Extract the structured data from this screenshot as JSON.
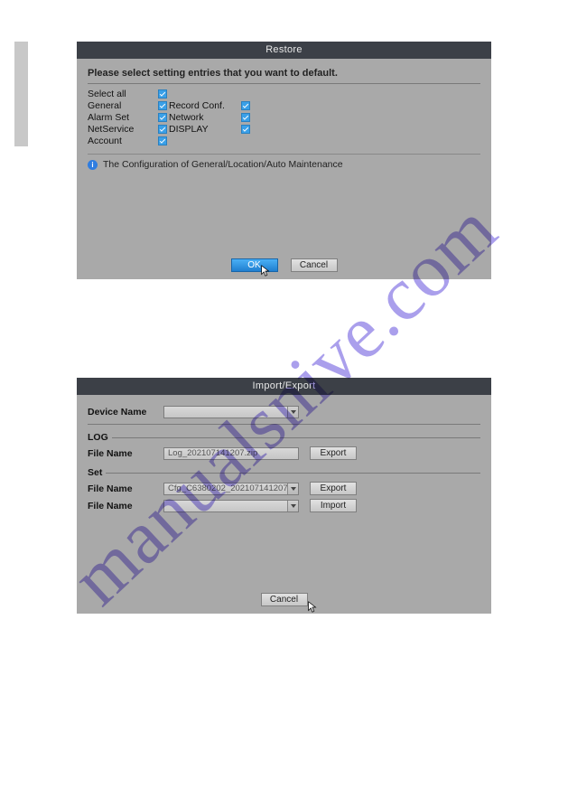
{
  "watermark": "manualsnive.com",
  "restore": {
    "title": "Restore",
    "instruction": "Please select setting entries that you want to default.",
    "checks_col1": [
      "Select all",
      "General",
      "Alarm Set",
      "NetService",
      "Account"
    ],
    "checks_col2": [
      "Record Conf.",
      "Network",
      "DISPLAY"
    ],
    "info": "The Configuration of General/Location/Auto Maintenance",
    "ok_label": "OK",
    "cancel_label": "Cancel"
  },
  "ie": {
    "title": "Import/Export",
    "device_name_label": "Device Name",
    "device_name_value": "",
    "log_section": "LOG",
    "log_file_label": "File Name",
    "log_file_value": "Log_202107141207.zip",
    "export_label": "Export",
    "set_section": "Set",
    "set_file_label": "File Name",
    "set_file_value": "Cfg_C6380202_202107141207.",
    "import_file_label": "File Name",
    "import_file_value": "",
    "import_label": "Import",
    "cancel_label": "Cancel"
  }
}
